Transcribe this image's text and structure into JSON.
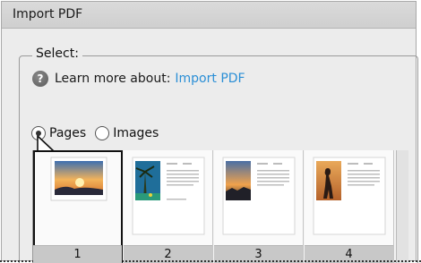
{
  "window": {
    "title": "Import PDF"
  },
  "select_group": {
    "legend": "Select:"
  },
  "help": {
    "text": "Learn more about:",
    "link_text": "Import PDF"
  },
  "mode": {
    "options": [
      {
        "label": "Pages",
        "checked": true
      },
      {
        "label": "Images",
        "checked": false
      }
    ]
  },
  "thumbnails": [
    {
      "page": "1",
      "selected": true
    },
    {
      "page": "2",
      "selected": false
    },
    {
      "page": "3",
      "selected": false
    },
    {
      "page": "4",
      "selected": false
    }
  ],
  "colors": {
    "link": "#2b8fd6",
    "titlebar": "#d4d4d4",
    "background": "#ececec"
  },
  "icons": {
    "help": "question-circle-icon",
    "cursor": "mouse-pointer-icon"
  }
}
